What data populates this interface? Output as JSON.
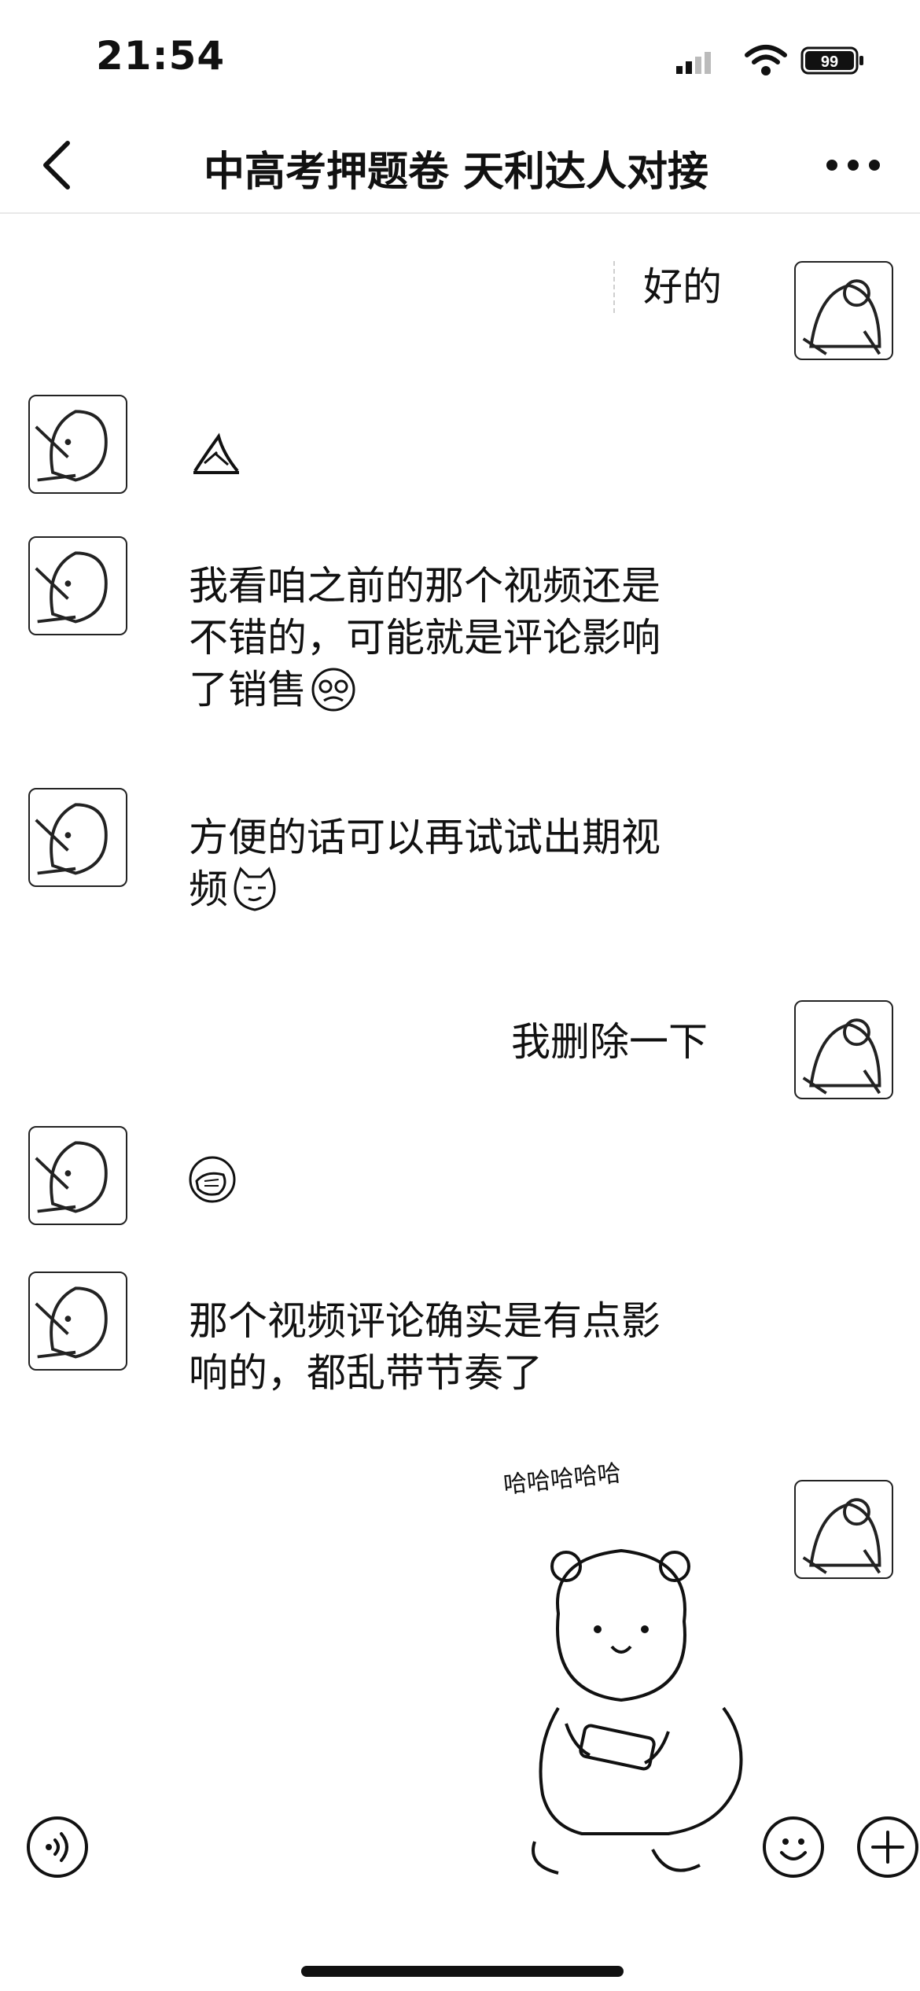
{
  "status_bar": {
    "time": "21:54",
    "battery": "99"
  },
  "header": {
    "title": "中高考押题卷 天利达人对接"
  },
  "messages": {
    "m1": {
      "text": "好的"
    },
    "m3": {
      "line1": "我看咱之前的那个视频还是",
      "line2": "不错的，可能就是评论影响",
      "line3": "了销售"
    },
    "m4": {
      "line1": "方便的话可以再试试出期视",
      "line2": "频"
    },
    "m5": {
      "text": "我删除一下"
    },
    "m7": {
      "line1": "那个视频评论确实是有点影",
      "line2": "响的，都乱带节奏了"
    },
    "sticker": {
      "caption": "哈哈哈哈哈"
    }
  },
  "icons": {
    "back": "chevron-left-icon",
    "more": "more-icon",
    "voice": "voice-icon",
    "emoji": "emoji-icon",
    "plus": "plus-icon"
  }
}
